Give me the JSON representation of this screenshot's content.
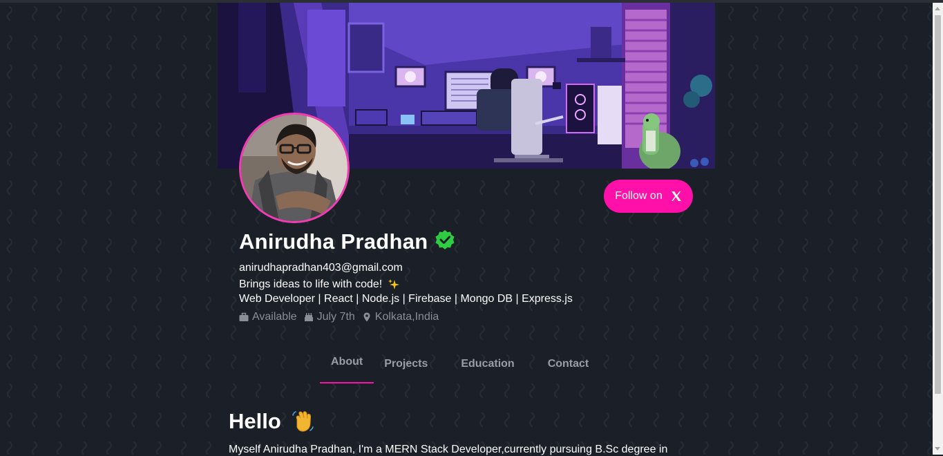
{
  "profile": {
    "name": "Anirudha Pradhan",
    "email": "anirudhapradhan403@gmail.com",
    "tagline": "Brings ideas to life with code!",
    "skills": "Web Developer | React | Node.js | Firebase | Mongo DB | Express.js",
    "status": "Available",
    "birthday": "July 7th",
    "location": "Kolkata,India"
  },
  "follow_button": {
    "label": "Follow on"
  },
  "tabs": [
    {
      "label": "About"
    },
    {
      "label": "Projects"
    },
    {
      "label": "Education"
    },
    {
      "label": "Contact"
    }
  ],
  "about": {
    "heading": "Hello",
    "text": "Myself Anirudha Pradhan, I'm a MERN Stack Developer,currently pursuing B.Sc degree in"
  },
  "icons": {
    "verified": "verified-badge-icon",
    "sparkle": "sparkles-icon",
    "status": "briefcase-icon",
    "birthday": "cake-icon",
    "location": "map-pin-icon",
    "wave": "waving-hand-icon",
    "x": "x-logo-icon"
  },
  "colors": {
    "accent": "#ff10a8",
    "avatar_border": "#f23bb5",
    "verified": "#2ecc40",
    "background": "#1b1f27",
    "muted": "#8b8f95"
  }
}
